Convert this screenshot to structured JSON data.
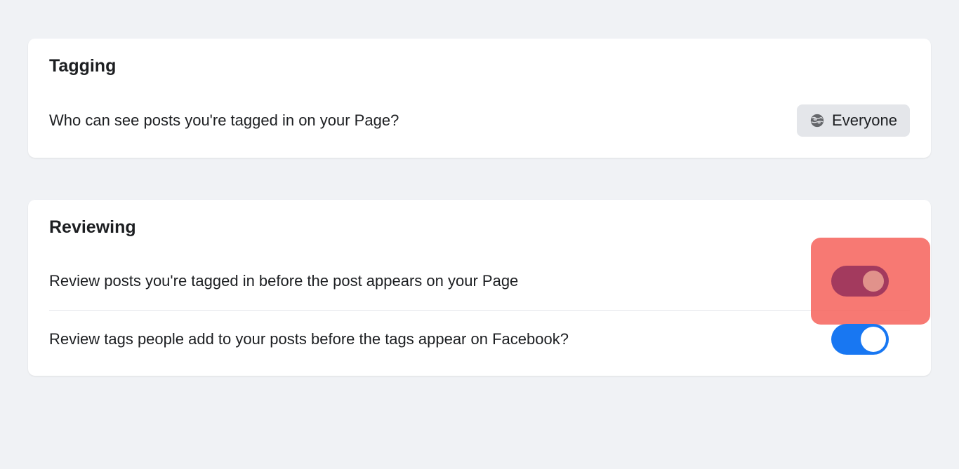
{
  "tagging": {
    "title": "Tagging",
    "visibility": {
      "label": "Who can see posts you're tagged in on your Page?",
      "selected": "Everyone",
      "icon": "globe-icon"
    }
  },
  "reviewing": {
    "title": "Reviewing",
    "items": [
      {
        "label": "Review posts you're tagged in before the post appears on your Page",
        "enabled": true,
        "highlighted": true
      },
      {
        "label": "Review tags people add to your posts before the tags appear on Facebook?",
        "enabled": true,
        "highlighted": false
      }
    ]
  }
}
